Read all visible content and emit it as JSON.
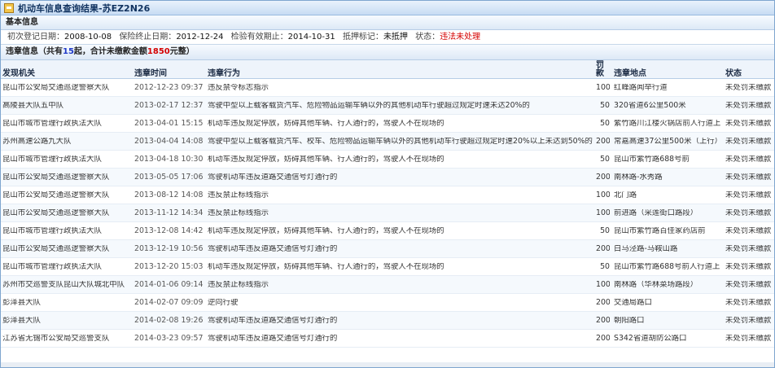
{
  "window": {
    "title": "机动车信息查询结果-苏EZ2N26"
  },
  "basic": {
    "header": "基本信息",
    "fields": [
      {
        "label": "初次登记日期：",
        "value": "2008-10-08"
      },
      {
        "label": "保险终止日期：",
        "value": "2012-12-24"
      },
      {
        "label": "检验有效期止：",
        "value": "2014-10-31"
      },
      {
        "label": "抵押标记：",
        "value": "未抵押"
      },
      {
        "label": "状态：",
        "value": "违法未处理"
      }
    ]
  },
  "summary": {
    "prefix": "违章信息（共有",
    "count": "15",
    "middle": "起，合计未缴款金额",
    "amount": "1850",
    "suffix": "元整）"
  },
  "table": {
    "headers": [
      "发现机关",
      "违章时间",
      "违章行为",
      "罚款",
      "违章地点",
      "状态"
    ],
    "rows": [
      [
        "昆山市公安局交通巡逻警察大队",
        "2012-12-23 09:37",
        "违反禁令标志指示",
        "100",
        "红峰路闻举行道",
        "未处罚未缴款"
      ],
      [
        "高陵县大队五中队",
        "2013-02-17 12:37",
        "驾驶中型以上载客载货汽车、危险物品运输车辆以外的其他机动车行驶超过规定时速未达20%的",
        "50",
        "320省道6公里500米",
        "未处罚未缴款"
      ],
      [
        "昆山市城市管理行政执法大队",
        "2013-04-01 15:15",
        "机动车违反规定停放，妨碍其他车辆、行人通行的，驾驶人不在现场的",
        "50",
        "紫竹路川江楼火锅店前人行道上",
        "未处罚未缴款"
      ],
      [
        "苏州高速公路九大队",
        "2013-04-04 14:08",
        "驾驶中型以上载客载货汽车、校车、危险物品运输车辆以外的其他机动车行驶超过规定时速20%以上未达到50%的",
        "200",
        "常嘉高速37公里500米（上行）",
        "未处罚未缴款"
      ],
      [
        "昆山市城市管理行政执法大队",
        "2013-04-18 10:30",
        "机动车违反规定停放，妨碍其他车辆、行人通行的，驾驶人不在现场的",
        "50",
        "昆山市紫竹路688号前",
        "未处罚未缴款"
      ],
      [
        "昆山市公安局交通巡逻警察大队",
        "2013-05-05 17:06",
        "驾驶机动车违反道路交通信号灯通行的",
        "200",
        "南林路-水秀路",
        "未处罚未缴款"
      ],
      [
        "昆山市公安局交通巡逻警察大队",
        "2013-08-12 14:08",
        "违反禁止标线指示",
        "100",
        "北门路",
        "未处罚未缴款"
      ],
      [
        "昆山市公安局交通巡逻警察大队",
        "2013-11-12 14:34",
        "违反禁止标线指示",
        "100",
        "前进路（采莲街口路段）",
        "未处罚未缴款"
      ],
      [
        "昆山市城市管理行政执法大队",
        "2013-12-08 14:42",
        "机动车违反规定停放，妨碍其他车辆、行人通行的，驾驶人不在现场的",
        "50",
        "昆山市紫竹路百佳家药店前",
        "未处罚未缴款"
      ],
      [
        "昆山市公安局交通巡逻警察大队",
        "2013-12-19 10:56",
        "驾驶机动车违反道路交通信号灯通行的",
        "200",
        "白马泾路-马鞍山路",
        "未处罚未缴款"
      ],
      [
        "昆山市城市管理行政执法大队",
        "2013-12-20 15:03",
        "机动车违反规定停放，妨碍其他车辆、行人通行的，驾驶人不在现场的",
        "50",
        "昆山市紫竹路688号前人行道上",
        "未处罚未缴款"
      ],
      [
        "苏州市交巡警支队昆山大队城北中队",
        "2014-01-06 09:14",
        "违反禁止标线指示",
        "100",
        "南林路（华林菜场路段）",
        "未处罚未缴款"
      ],
      [
        "彭泽县大队",
        "2014-02-07 09:09",
        "逆向行驶",
        "200",
        "交通局路口",
        "未处罚未缴款"
      ],
      [
        "彭泽县大队",
        "2014-02-08 19:26",
        "驾驶机动车违反道路交通信号灯通行的",
        "200",
        "朝阳路口",
        "未处罚未缴款"
      ],
      [
        "江苏省无锡市公安局交巡警支队",
        "2014-03-23 09:57",
        "驾驶机动车违反道路交通信号灯通行的",
        "200",
        "S342省道胡防公路口",
        "未处罚未缴款"
      ]
    ]
  }
}
